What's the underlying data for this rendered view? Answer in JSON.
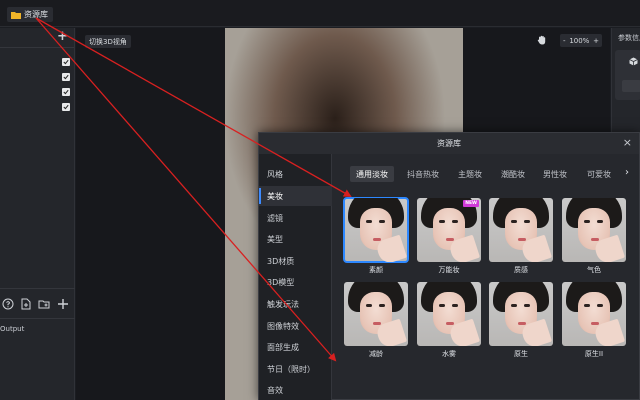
{
  "colors": {
    "accent": "#2d88ff",
    "annotation": "#d82020",
    "new_badge": "#d13ad9"
  },
  "top_tab": {
    "label": "资源库",
    "icon": "folder-icon"
  },
  "left_panel": {
    "plus_label": "+",
    "checks": 4,
    "toolbar_icons": [
      "help-icon",
      "file-add-icon",
      "folder-add-icon",
      "plus-icon"
    ],
    "output_label": "Output"
  },
  "viewport": {
    "toggle_3d_label": "切换3D视角",
    "zoom": {
      "minus": "-",
      "value": "100%",
      "plus": "+"
    }
  },
  "right_panel": {
    "title": "参数信息"
  },
  "modal": {
    "title": "资源库",
    "close": "×",
    "categories": [
      "风格",
      "美妆",
      "滤镜",
      "美型",
      "3D材质",
      "3D模型",
      "触发玩法",
      "图像特效",
      "面部生成",
      "节日（限时）",
      "音效"
    ],
    "active_category": "美妆",
    "subtabs": [
      "通用淡妆",
      "抖音热妆",
      "主题妆",
      "潮酷妆",
      "男性妆",
      "可爱妆"
    ],
    "active_subtab": "通用淡妆",
    "more_arrow": "›",
    "items": [
      {
        "label": "素颜",
        "selected": true,
        "badge": ""
      },
      {
        "label": "万能妆",
        "selected": false,
        "badge": "NEW"
      },
      {
        "label": "质感",
        "selected": false,
        "badge": ""
      },
      {
        "label": "气色",
        "selected": false,
        "badge": ""
      },
      {
        "label": "减龄",
        "selected": false,
        "badge": ""
      },
      {
        "label": "水雾",
        "selected": false,
        "badge": ""
      },
      {
        "label": "原生",
        "selected": false,
        "badge": ""
      },
      {
        "label": "原生II",
        "selected": false,
        "badge": ""
      }
    ]
  }
}
